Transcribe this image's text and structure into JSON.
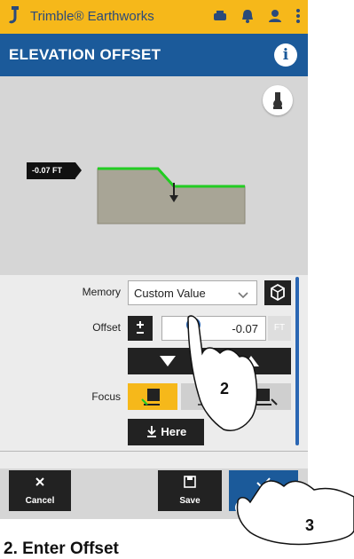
{
  "app": {
    "title": "Trimble® Earthworks"
  },
  "statusbar": {
    "icons": [
      "storage-icon",
      "bell-icon",
      "user-icon",
      "more-icon"
    ]
  },
  "header": {
    "title": "ELEVATION OFFSET"
  },
  "view": {
    "offset_label": "-0.07 FT"
  },
  "form": {
    "memory_label": "Memory",
    "memory_value": "Custom Value",
    "offset_label": "Offset",
    "offset_value": "-0.07",
    "offset_unit": "FT",
    "focus_label": "Focus",
    "here_label": "Here"
  },
  "footer": {
    "cancel_label": "Cancel",
    "save_label": "Save",
    "apply_label": "Apply"
  },
  "annotations": {
    "callout_2": "2",
    "callout_3": "3",
    "caption": "2. Enter Offset"
  },
  "colors": {
    "brand_yellow": "#f6b81a",
    "header_blue": "#1b5a9a",
    "accent_green": "#22cc22",
    "focus_yellow": "#f6b81a"
  }
}
